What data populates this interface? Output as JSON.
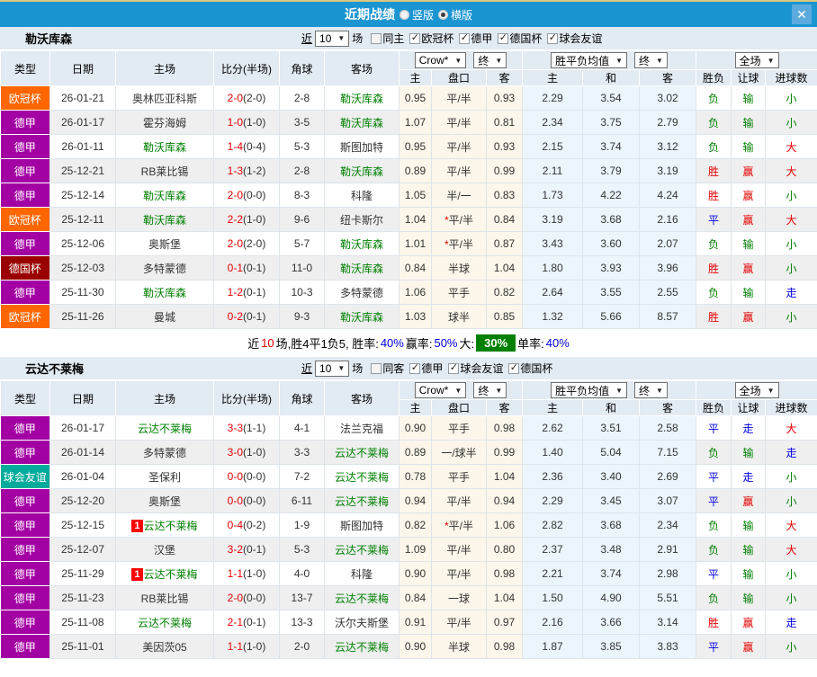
{
  "titlebar": {
    "title": "近期战绩",
    "layout_options": [
      {
        "label": "竖版",
        "selected": false
      },
      {
        "label": "横版",
        "selected": true
      }
    ],
    "close_label": "✕"
  },
  "filter_words": {
    "near": "近",
    "games": "场"
  },
  "table": {
    "columns": [
      "类型",
      "日期",
      "主场",
      "比分(半场)",
      "角球",
      "客场",
      "主",
      "盘口",
      "客",
      "主",
      "和",
      "客",
      "胜负",
      "让球",
      "进球数"
    ],
    "dropdowns": {
      "company": "Crow*",
      "final_a": "终",
      "avg": "胜平负均值",
      "final_b": "终",
      "scope": "全场"
    }
  },
  "colors": {
    "titlebar_bg": "#1b95d2",
    "header_bg": "#e2eaf2",
    "odds_panel_bg": "#fdf6ea",
    "avg_panel_bg": "#ebf5fb",
    "team_highlight": "#008000",
    "score_red": "#e60000",
    "type_colors": {
      "欧冠杯": "#ff6600",
      "德甲": "#a300a3",
      "德国杯": "#9b0000",
      "球会友谊": "#00ab9b"
    },
    "result_colors": {
      "胜": "#e60000",
      "赢": "#e60000",
      "大": "#e60000",
      "平": "#0000e6",
      "走": "#0000e6",
      "负": "#008000",
      "输": "#008000",
      "小": "#008000"
    }
  },
  "sections": [
    {
      "team": "勒沃库森",
      "near_count": "10",
      "same_option": {
        "label": "同主",
        "checked": false
      },
      "league_options": [
        {
          "label": "欧冠杯",
          "checked": true
        },
        {
          "label": "德甲",
          "checked": true
        },
        {
          "label": "德国杯",
          "checked": true
        },
        {
          "label": "球会友谊",
          "checked": true
        }
      ],
      "rows": [
        {
          "type": "欧冠杯",
          "date": "26-01-21",
          "home": "奥林匹亚科斯",
          "home_hl": false,
          "home_badge": "",
          "score": "2-0",
          "half": "(2-0)",
          "corners": "2-8",
          "away": "勒沃库森",
          "away_hl": true,
          "away_badge": "",
          "odds": [
            "0.95",
            "平/半",
            "0.93"
          ],
          "avg": [
            "2.29",
            "3.54",
            "3.02"
          ],
          "results": [
            "负",
            "输",
            "小"
          ]
        },
        {
          "type": "德甲",
          "date": "26-01-17",
          "home": "霍芬海姆",
          "home_hl": false,
          "home_badge": "",
          "score": "1-0",
          "half": "(1-0)",
          "corners": "3-5",
          "away": "勒沃库森",
          "away_hl": true,
          "away_badge": "",
          "odds": [
            "1.07",
            "平/半",
            "0.81"
          ],
          "avg": [
            "2.34",
            "3.75",
            "2.79"
          ],
          "results": [
            "负",
            "输",
            "小"
          ]
        },
        {
          "type": "德甲",
          "date": "26-01-11",
          "home": "勒沃库森",
          "home_hl": true,
          "home_badge": "",
          "score": "1-4",
          "half": "(0-4)",
          "corners": "5-3",
          "away": "斯图加特",
          "away_hl": false,
          "away_badge": "",
          "odds": [
            "0.95",
            "平/半",
            "0.93"
          ],
          "avg": [
            "2.15",
            "3.74",
            "3.12"
          ],
          "results": [
            "负",
            "输",
            "大"
          ]
        },
        {
          "type": "德甲",
          "date": "25-12-21",
          "home": "RB莱比锡",
          "home_hl": false,
          "home_badge": "",
          "score": "1-3",
          "half": "(1-2)",
          "corners": "2-8",
          "away": "勒沃库森",
          "away_hl": true,
          "away_badge": "",
          "odds": [
            "0.89",
            "平/半",
            "0.99"
          ],
          "avg": [
            "2.11",
            "3.79",
            "3.19"
          ],
          "results": [
            "胜",
            "赢",
            "大"
          ]
        },
        {
          "type": "德甲",
          "date": "25-12-14",
          "home": "勒沃库森",
          "home_hl": true,
          "home_badge": "",
          "score": "2-0",
          "half": "(0-0)",
          "corners": "8-3",
          "away": "科隆",
          "away_hl": false,
          "away_badge": "",
          "odds": [
            "1.05",
            "半/一",
            "0.83"
          ],
          "avg": [
            "1.73",
            "4.22",
            "4.24"
          ],
          "results": [
            "胜",
            "赢",
            "小"
          ]
        },
        {
          "type": "欧冠杯",
          "date": "25-12-11",
          "home": "勒沃库森",
          "home_hl": true,
          "home_badge": "",
          "score": "2-2",
          "half": "(1-0)",
          "corners": "9-6",
          "away": "纽卡斯尔",
          "away_hl": false,
          "away_badge": "",
          "odds": [
            "1.04",
            "*平/半",
            "0.84"
          ],
          "avg": [
            "3.19",
            "3.68",
            "2.16"
          ],
          "results": [
            "平",
            "赢",
            "大"
          ]
        },
        {
          "type": "德甲",
          "date": "25-12-06",
          "home": "奥斯堡",
          "home_hl": false,
          "home_badge": "",
          "score": "2-0",
          "half": "(2-0)",
          "corners": "5-7",
          "away": "勒沃库森",
          "away_hl": true,
          "away_badge": "",
          "odds": [
            "1.01",
            "*平/半",
            "0.87"
          ],
          "avg": [
            "3.43",
            "3.60",
            "2.07"
          ],
          "results": [
            "负",
            "输",
            "小"
          ]
        },
        {
          "type": "德国杯",
          "date": "25-12-03",
          "home": "多特蒙德",
          "home_hl": false,
          "home_badge": "",
          "score": "0-1",
          "half": "(0-1)",
          "corners": "11-0",
          "away": "勒沃库森",
          "away_hl": true,
          "away_badge": "",
          "odds": [
            "0.84",
            "半球",
            "1.04"
          ],
          "avg": [
            "1.80",
            "3.93",
            "3.96"
          ],
          "results": [
            "胜",
            "赢",
            "小"
          ]
        },
        {
          "type": "德甲",
          "date": "25-11-30",
          "home": "勒沃库森",
          "home_hl": true,
          "home_badge": "",
          "score": "1-2",
          "half": "(0-1)",
          "corners": "10-3",
          "away": "多特蒙德",
          "away_hl": false,
          "away_badge": "",
          "odds": [
            "1.06",
            "平手",
            "0.82"
          ],
          "avg": [
            "2.64",
            "3.55",
            "2.55"
          ],
          "results": [
            "负",
            "输",
            "走"
          ]
        },
        {
          "type": "欧冠杯",
          "date": "25-11-26",
          "home": "曼城",
          "home_hl": false,
          "home_badge": "",
          "score": "0-2",
          "half": "(0-1)",
          "corners": "9-3",
          "away": "勒沃库森",
          "away_hl": true,
          "away_badge": "",
          "odds": [
            "1.03",
            "球半",
            "0.85"
          ],
          "avg": [
            "1.32",
            "5.66",
            "8.57"
          ],
          "results": [
            "胜",
            "赢",
            "小"
          ]
        }
      ],
      "summary": [
        {
          "text": "近",
          "style": "plain"
        },
        {
          "text": "10",
          "style": "red"
        },
        {
          "text": "场,胜4平1负5, 胜率:",
          "style": "plain"
        },
        {
          "text": "40%",
          "style": "blue"
        },
        {
          "text": " 赢率:",
          "style": "plain"
        },
        {
          "text": "50%",
          "style": "blue"
        },
        {
          "text": " 大:",
          "style": "plain"
        },
        {
          "text": "30%",
          "style": "greenbox"
        },
        {
          "text": " 单率:",
          "style": "plain"
        },
        {
          "text": "40%",
          "style": "blue"
        }
      ]
    },
    {
      "team": "云达不莱梅",
      "near_count": "10",
      "same_option": {
        "label": "同客",
        "checked": false
      },
      "league_options": [
        {
          "label": "德甲",
          "checked": true
        },
        {
          "label": "球会友谊",
          "checked": true
        },
        {
          "label": "德国杯",
          "checked": true
        }
      ],
      "rows": [
        {
          "type": "德甲",
          "date": "26-01-17",
          "home": "云达不莱梅",
          "home_hl": true,
          "home_badge": "",
          "score": "3-3",
          "half": "(1-1)",
          "corners": "4-1",
          "away": "法兰克福",
          "away_hl": false,
          "away_badge": "",
          "odds": [
            "0.90",
            "平手",
            "0.98"
          ],
          "avg": [
            "2.62",
            "3.51",
            "2.58"
          ],
          "results": [
            "平",
            "走",
            "大"
          ]
        },
        {
          "type": "德甲",
          "date": "26-01-14",
          "home": "多特蒙德",
          "home_hl": false,
          "home_badge": "",
          "score": "3-0",
          "half": "(1-0)",
          "corners": "3-3",
          "away": "云达不莱梅",
          "away_hl": true,
          "away_badge": "",
          "odds": [
            "0.89",
            "一/球半",
            "0.99"
          ],
          "avg": [
            "1.40",
            "5.04",
            "7.15"
          ],
          "results": [
            "负",
            "输",
            "走"
          ]
        },
        {
          "type": "球会友谊",
          "date": "26-01-04",
          "home": "圣保利",
          "home_hl": false,
          "home_badge": "",
          "score": "0-0",
          "half": "(0-0)",
          "corners": "7-2",
          "away": "云达不莱梅",
          "away_hl": true,
          "away_badge": "",
          "odds": [
            "0.78",
            "平手",
            "1.04"
          ],
          "avg": [
            "2.36",
            "3.40",
            "2.69"
          ],
          "results": [
            "平",
            "走",
            "小"
          ]
        },
        {
          "type": "德甲",
          "date": "25-12-20",
          "home": "奥斯堡",
          "home_hl": false,
          "home_badge": "",
          "score": "0-0",
          "half": "(0-0)",
          "corners": "6-11",
          "away": "云达不莱梅",
          "away_hl": true,
          "away_badge": "",
          "odds": [
            "0.94",
            "平/半",
            "0.94"
          ],
          "avg": [
            "2.29",
            "3.45",
            "3.07"
          ],
          "results": [
            "平",
            "赢",
            "小"
          ]
        },
        {
          "type": "德甲",
          "date": "25-12-15",
          "home": "云达不莱梅",
          "home_hl": true,
          "home_badge": "1",
          "score": "0-4",
          "half": "(0-2)",
          "corners": "1-9",
          "away": "斯图加特",
          "away_hl": false,
          "away_badge": "",
          "odds": [
            "0.82",
            "*平/半",
            "1.06"
          ],
          "avg": [
            "2.82",
            "3.68",
            "2.34"
          ],
          "results": [
            "负",
            "输",
            "大"
          ]
        },
        {
          "type": "德甲",
          "date": "25-12-07",
          "home": "汉堡",
          "home_hl": false,
          "home_badge": "",
          "score": "3-2",
          "half": "(0-1)",
          "corners": "5-3",
          "away": "云达不莱梅",
          "away_hl": true,
          "away_badge": "",
          "odds": [
            "1.09",
            "平/半",
            "0.80"
          ],
          "avg": [
            "2.37",
            "3.48",
            "2.91"
          ],
          "results": [
            "负",
            "输",
            "大"
          ]
        },
        {
          "type": "德甲",
          "date": "25-11-29",
          "home": "云达不莱梅",
          "home_hl": true,
          "home_badge": "1",
          "score": "1-1",
          "half": "(1-0)",
          "corners": "4-0",
          "away": "科隆",
          "away_hl": false,
          "away_badge": "",
          "odds": [
            "0.90",
            "平/半",
            "0.98"
          ],
          "avg": [
            "2.21",
            "3.74",
            "2.98"
          ],
          "results": [
            "平",
            "输",
            "小"
          ]
        },
        {
          "type": "德甲",
          "date": "25-11-23",
          "home": "RB莱比锡",
          "home_hl": false,
          "home_badge": "",
          "score": "2-0",
          "half": "(0-0)",
          "corners": "13-7",
          "away": "云达不莱梅",
          "away_hl": true,
          "away_badge": "",
          "odds": [
            "0.84",
            "一球",
            "1.04"
          ],
          "avg": [
            "1.50",
            "4.90",
            "5.51"
          ],
          "results": [
            "负",
            "输",
            "小"
          ]
        },
        {
          "type": "德甲",
          "date": "25-11-08",
          "home": "云达不莱梅",
          "home_hl": true,
          "home_badge": "",
          "score": "2-1",
          "half": "(0-1)",
          "corners": "13-3",
          "away": "沃尔夫斯堡",
          "away_hl": false,
          "away_badge": "",
          "odds": [
            "0.91",
            "平/半",
            "0.97"
          ],
          "avg": [
            "2.16",
            "3.66",
            "3.14"
          ],
          "results": [
            "胜",
            "赢",
            "走"
          ]
        },
        {
          "type": "德甲",
          "date": "25-11-01",
          "home": "美因茨05",
          "home_hl": false,
          "home_badge": "",
          "score": "1-1",
          "half": "(1-0)",
          "corners": "2-0",
          "away": "云达不莱梅",
          "away_hl": true,
          "away_badge": "",
          "odds": [
            "0.90",
            "半球",
            "0.98"
          ],
          "avg": [
            "1.87",
            "3.85",
            "3.83"
          ],
          "results": [
            "平",
            "赢",
            "小"
          ]
        }
      ],
      "summary": []
    }
  ]
}
